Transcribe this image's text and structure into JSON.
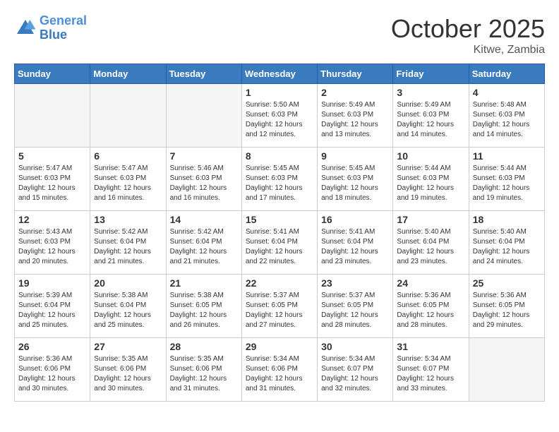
{
  "header": {
    "logo": "General Blue",
    "month": "October 2025",
    "location": "Kitwe, Zambia"
  },
  "weekdays": [
    "Sunday",
    "Monday",
    "Tuesday",
    "Wednesday",
    "Thursday",
    "Friday",
    "Saturday"
  ],
  "weeks": [
    [
      {
        "day": "",
        "info": ""
      },
      {
        "day": "",
        "info": ""
      },
      {
        "day": "",
        "info": ""
      },
      {
        "day": "1",
        "info": "Sunrise: 5:50 AM\nSunset: 6:03 PM\nDaylight: 12 hours and 12 minutes."
      },
      {
        "day": "2",
        "info": "Sunrise: 5:49 AM\nSunset: 6:03 PM\nDaylight: 12 hours and 13 minutes."
      },
      {
        "day": "3",
        "info": "Sunrise: 5:49 AM\nSunset: 6:03 PM\nDaylight: 12 hours and 14 minutes."
      },
      {
        "day": "4",
        "info": "Sunrise: 5:48 AM\nSunset: 6:03 PM\nDaylight: 12 hours and 14 minutes."
      }
    ],
    [
      {
        "day": "5",
        "info": "Sunrise: 5:47 AM\nSunset: 6:03 PM\nDaylight: 12 hours and 15 minutes."
      },
      {
        "day": "6",
        "info": "Sunrise: 5:47 AM\nSunset: 6:03 PM\nDaylight: 12 hours and 16 minutes."
      },
      {
        "day": "7",
        "info": "Sunrise: 5:46 AM\nSunset: 6:03 PM\nDaylight: 12 hours and 16 minutes."
      },
      {
        "day": "8",
        "info": "Sunrise: 5:45 AM\nSunset: 6:03 PM\nDaylight: 12 hours and 17 minutes."
      },
      {
        "day": "9",
        "info": "Sunrise: 5:45 AM\nSunset: 6:03 PM\nDaylight: 12 hours and 18 minutes."
      },
      {
        "day": "10",
        "info": "Sunrise: 5:44 AM\nSunset: 6:03 PM\nDaylight: 12 hours and 19 minutes."
      },
      {
        "day": "11",
        "info": "Sunrise: 5:44 AM\nSunset: 6:03 PM\nDaylight: 12 hours and 19 minutes."
      }
    ],
    [
      {
        "day": "12",
        "info": "Sunrise: 5:43 AM\nSunset: 6:03 PM\nDaylight: 12 hours and 20 minutes."
      },
      {
        "day": "13",
        "info": "Sunrise: 5:42 AM\nSunset: 6:04 PM\nDaylight: 12 hours and 21 minutes."
      },
      {
        "day": "14",
        "info": "Sunrise: 5:42 AM\nSunset: 6:04 PM\nDaylight: 12 hours and 21 minutes."
      },
      {
        "day": "15",
        "info": "Sunrise: 5:41 AM\nSunset: 6:04 PM\nDaylight: 12 hours and 22 minutes."
      },
      {
        "day": "16",
        "info": "Sunrise: 5:41 AM\nSunset: 6:04 PM\nDaylight: 12 hours and 23 minutes."
      },
      {
        "day": "17",
        "info": "Sunrise: 5:40 AM\nSunset: 6:04 PM\nDaylight: 12 hours and 23 minutes."
      },
      {
        "day": "18",
        "info": "Sunrise: 5:40 AM\nSunset: 6:04 PM\nDaylight: 12 hours and 24 minutes."
      }
    ],
    [
      {
        "day": "19",
        "info": "Sunrise: 5:39 AM\nSunset: 6:04 PM\nDaylight: 12 hours and 25 minutes."
      },
      {
        "day": "20",
        "info": "Sunrise: 5:38 AM\nSunset: 6:04 PM\nDaylight: 12 hours and 25 minutes."
      },
      {
        "day": "21",
        "info": "Sunrise: 5:38 AM\nSunset: 6:05 PM\nDaylight: 12 hours and 26 minutes."
      },
      {
        "day": "22",
        "info": "Sunrise: 5:37 AM\nSunset: 6:05 PM\nDaylight: 12 hours and 27 minutes."
      },
      {
        "day": "23",
        "info": "Sunrise: 5:37 AM\nSunset: 6:05 PM\nDaylight: 12 hours and 28 minutes."
      },
      {
        "day": "24",
        "info": "Sunrise: 5:36 AM\nSunset: 6:05 PM\nDaylight: 12 hours and 28 minutes."
      },
      {
        "day": "25",
        "info": "Sunrise: 5:36 AM\nSunset: 6:05 PM\nDaylight: 12 hours and 29 minutes."
      }
    ],
    [
      {
        "day": "26",
        "info": "Sunrise: 5:36 AM\nSunset: 6:06 PM\nDaylight: 12 hours and 30 minutes."
      },
      {
        "day": "27",
        "info": "Sunrise: 5:35 AM\nSunset: 6:06 PM\nDaylight: 12 hours and 30 minutes."
      },
      {
        "day": "28",
        "info": "Sunrise: 5:35 AM\nSunset: 6:06 PM\nDaylight: 12 hours and 31 minutes."
      },
      {
        "day": "29",
        "info": "Sunrise: 5:34 AM\nSunset: 6:06 PM\nDaylight: 12 hours and 31 minutes."
      },
      {
        "day": "30",
        "info": "Sunrise: 5:34 AM\nSunset: 6:07 PM\nDaylight: 12 hours and 32 minutes."
      },
      {
        "day": "31",
        "info": "Sunrise: 5:34 AM\nSunset: 6:07 PM\nDaylight: 12 hours and 33 minutes."
      },
      {
        "day": "",
        "info": ""
      }
    ]
  ]
}
